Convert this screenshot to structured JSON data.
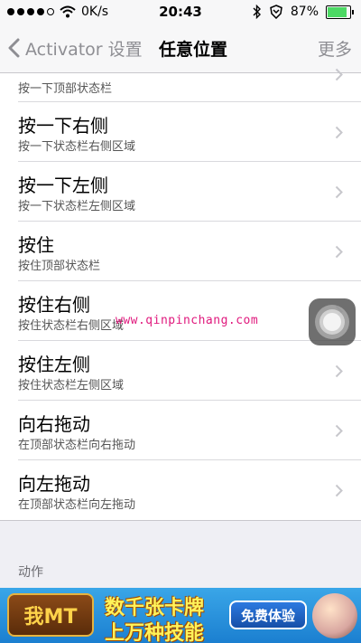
{
  "status_bar": {
    "carrier": "0K/s",
    "time": "20:43",
    "battery": "87%",
    "battery_level": 0.87,
    "icons": [
      "signal-dots-icon",
      "wifi-icon",
      "bluetooth-icon",
      "shield-icon",
      "battery-icon"
    ]
  },
  "nav": {
    "back_label": "Activator 设置",
    "title": "任意位置",
    "more_label": "更多"
  },
  "list": {
    "items": [
      {
        "subtitle": "按一下顶部状态栏"
      },
      {
        "title": "按一下右侧",
        "subtitle": "按一下状态栏右侧区域"
      },
      {
        "title": "按一下左侧",
        "subtitle": "按一下状态栏左侧区域"
      },
      {
        "title": "按住",
        "subtitle": "按住顶部状态栏"
      },
      {
        "title": "按住右侧",
        "subtitle": "按住状态栏右侧区域"
      },
      {
        "title": "按住左侧",
        "subtitle": "按住状态栏左侧区域"
      },
      {
        "title": "向右拖动",
        "subtitle": "在顶部状态栏向右拖动"
      },
      {
        "title": "向左拖动",
        "subtitle": "在顶部状态栏向左拖动"
      }
    ]
  },
  "section": {
    "header": "动作"
  },
  "watermark": "www.qinpinchang.com",
  "ad": {
    "logo_text": "我MT",
    "line1": "数千张卡牌",
    "line2": "上万种技能",
    "button": "免费体验"
  },
  "colors": {
    "background": "#efeff4",
    "nav_gray": "#8e8e93",
    "battery_green": "#4cd964",
    "watermark_pink": "#e0197d",
    "ad_blue": "#1b7fd0"
  }
}
